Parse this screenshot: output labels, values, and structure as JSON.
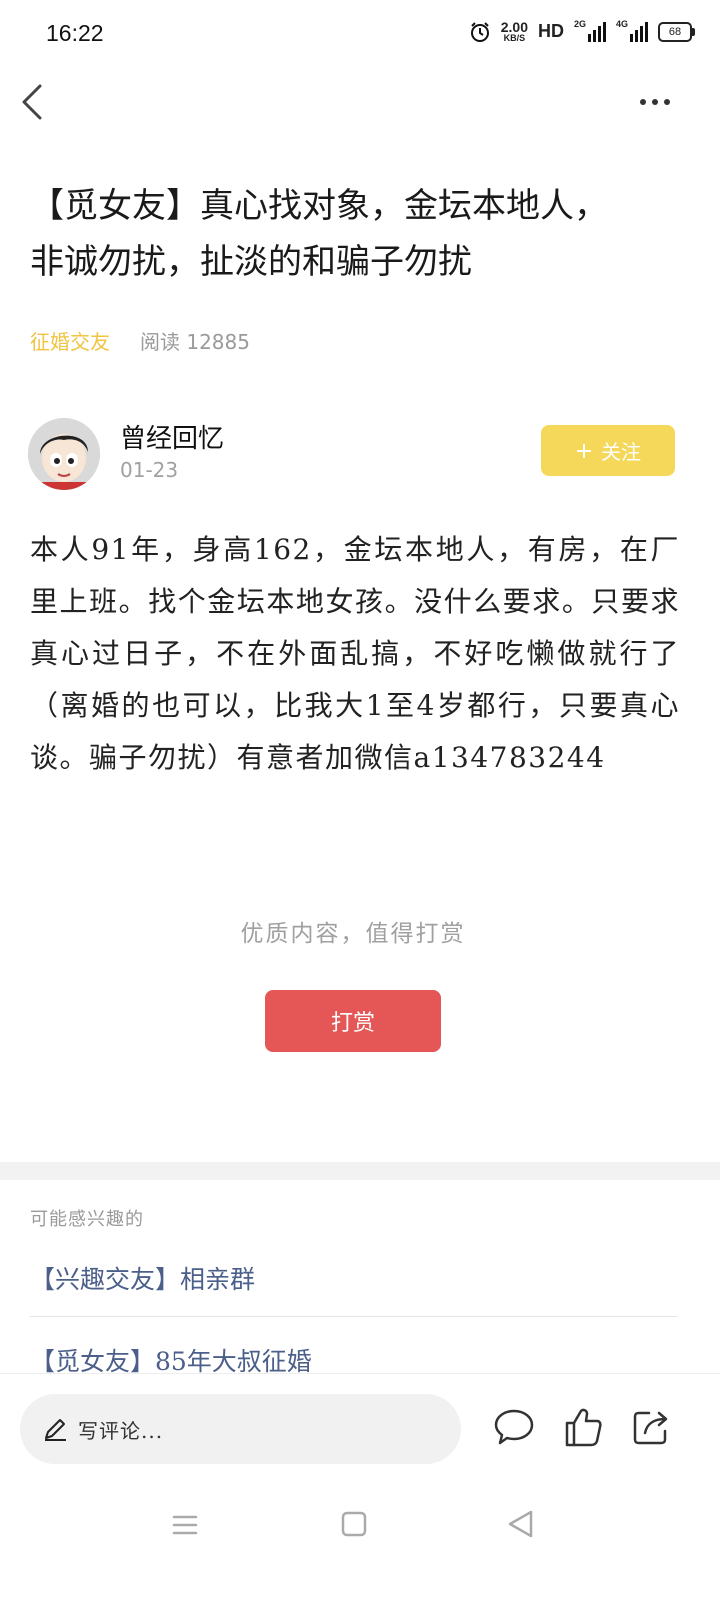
{
  "status_bar": {
    "time": "16:22",
    "net_speed_value": "2.00",
    "net_speed_unit": "KB/S",
    "hd_label": "HD",
    "signal1_label": "2G",
    "signal2_label": "4G",
    "battery": "68",
    "icons": [
      "alarm-icon",
      "signal-icon",
      "battery-icon"
    ]
  },
  "header": {
    "back_icon": "chevron-left-icon",
    "more_icon": "more-dots-icon"
  },
  "article": {
    "title": "【觅女友】真心找对象，金坛本地人，非诚勿扰，扯淡的和骗子勿扰",
    "category": "征婚交友",
    "reads_label": "阅读 12885",
    "author_name": "曾经回忆",
    "author_date": "01-23",
    "follow_label": "关注",
    "follow_icon": "plus-icon",
    "body": "本人91年，身高162，金坛本地人，有房，在厂里上班。找个金坛本地女孩。没什么要求。只要求真心过日子，不在外面乱搞，不好吃懒做就行了（离婚的也可以，比我大1至4岁都行，只要真心谈。骗子勿扰）有意者加微信a134783244"
  },
  "tip": {
    "text": "优质内容，值得打赏",
    "button_label": "打赏"
  },
  "related": {
    "heading": "可能感兴趣的",
    "items": [
      "【兴趣交友】相亲群",
      "【觅女友】85年大叔征婚"
    ]
  },
  "bottom_bar": {
    "comment_placeholder": "写评论...",
    "icons": [
      "pencil-icon",
      "comment-icon",
      "like-icon",
      "share-icon"
    ]
  },
  "nav_bar": {
    "icons": [
      "menu-icon",
      "home-icon",
      "back-icon"
    ]
  },
  "colors": {
    "accent_yellow": "#f5d85a",
    "category_yellow": "#f0c341",
    "tip_red": "#e55656",
    "related_blue": "#4b5f8a"
  }
}
